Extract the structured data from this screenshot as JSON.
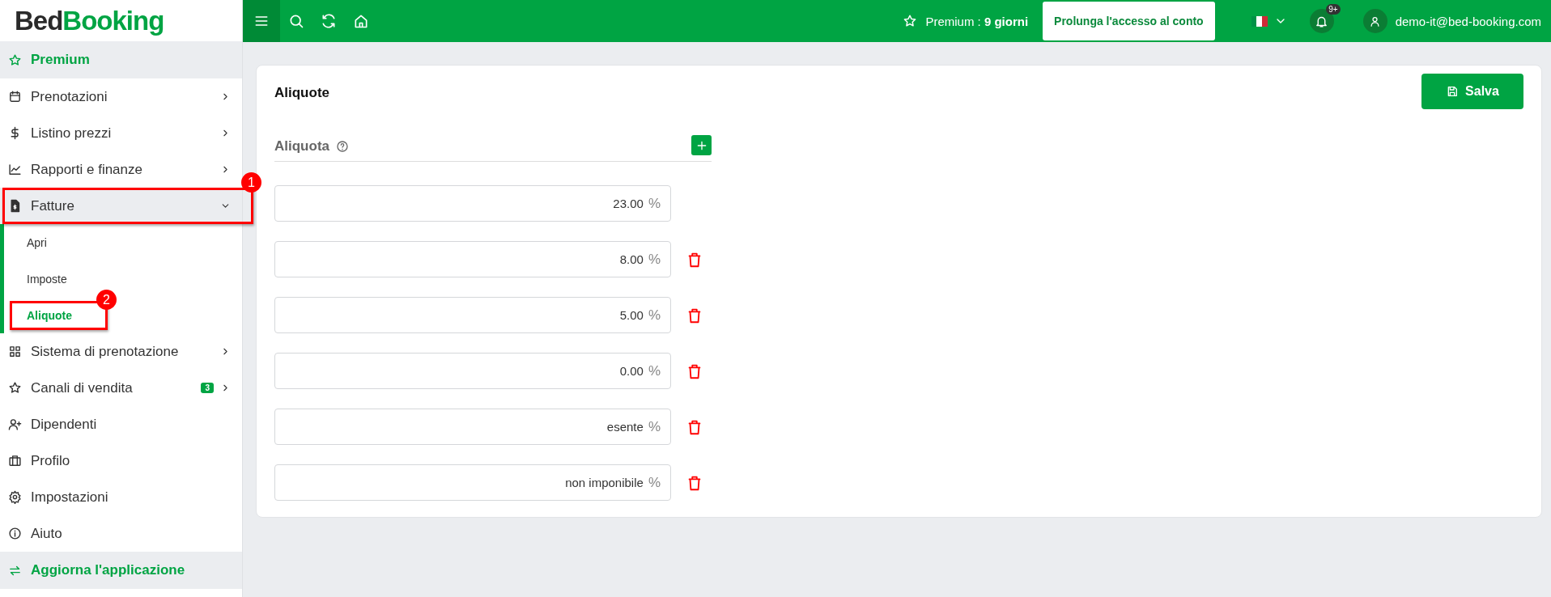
{
  "logo": {
    "dark": "Bed",
    "green": "Booking"
  },
  "topbar": {
    "premium": "Premium : **9 giorni**",
    "extend_button": "Prolunga l'accesso al conto",
    "notifications": "9+",
    "user": "demo-it@bed-booking.com"
  },
  "sidebar": {
    "items": [
      {
        "label": "Premium",
        "kind": "highlight"
      },
      {
        "label": "Prenotazioni",
        "kind": "submenu",
        "expanded": false
      },
      {
        "label": "Listino prezzi",
        "kind": "submenu",
        "expanded": false
      },
      {
        "label": "Rapporti e finanze",
        "kind": "submenu",
        "expanded": false
      },
      {
        "label": "Fatture",
        "kind": "submenu",
        "expanded": true,
        "callout": "1",
        "children": [
          {
            "label": "Apri",
            "selected": false
          },
          {
            "label": "Imposte",
            "selected": false
          },
          {
            "label": "Aliquote",
            "selected": true,
            "callout": "2"
          }
        ]
      },
      {
        "label": "Sistema di prenotazione",
        "kind": "submenu",
        "expanded": false
      },
      {
        "label": "Canali di vendita",
        "kind": "submenu",
        "expanded": false,
        "badge": "3"
      },
      {
        "label": "Dipendenti",
        "kind": "link"
      },
      {
        "label": "Profilo",
        "kind": "link"
      },
      {
        "label": "Impostazioni",
        "kind": "link"
      },
      {
        "label": "Aiuto",
        "kind": "link"
      },
      {
        "label": "Aggiorna l'applicazione",
        "kind": "highlight"
      }
    ]
  },
  "card": {
    "title": "Aliquote",
    "save_button": "Salva",
    "section_label": "Aliquota",
    "rates": [
      {
        "value": "23.00",
        "unit": "%",
        "deletable": false
      },
      {
        "value": "8.00",
        "unit": "%",
        "deletable": true
      },
      {
        "value": "5.00",
        "unit": "%",
        "deletable": true
      },
      {
        "value": "0.00",
        "unit": "%",
        "deletable": true
      },
      {
        "value": "esente",
        "unit": "%",
        "deletable": true
      },
      {
        "value": "non imponibile",
        "unit": "%",
        "deletable": true
      }
    ]
  }
}
